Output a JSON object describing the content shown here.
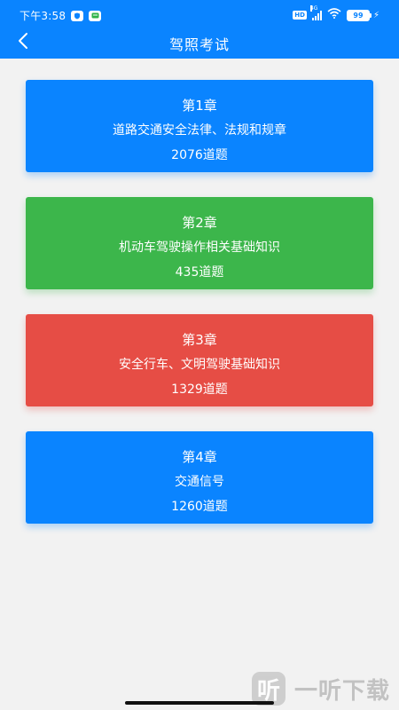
{
  "status_bar": {
    "time": "下午3:58",
    "icon_left_1": "shield-app",
    "icon_left_2": "message-app",
    "hd": "HD",
    "network": "4G",
    "battery": "99"
  },
  "app_bar": {
    "back_icon": "chevron-left-icon",
    "title": "驾照考试"
  },
  "chapters": [
    {
      "number": "第1章",
      "title": "道路交通安全法律、法规和规章",
      "count": "2076道题",
      "color": "#0a84ff"
    },
    {
      "number": "第2章",
      "title": "机动车驾驶操作相关基础知识",
      "count": "435道题",
      "color": "#3cb64b"
    },
    {
      "number": "第3章",
      "title": "安全行车、文明驾驶基础知识",
      "count": "1329道题",
      "color": "#e64d45"
    },
    {
      "number": "第4章",
      "title": "交通信号",
      "count": "1260道题",
      "color": "#0a84ff"
    }
  ],
  "watermark": {
    "logo": "听",
    "text": "一听下载"
  },
  "colors": {
    "primary": "#0a84ff",
    "background": "#f2f2f2"
  }
}
